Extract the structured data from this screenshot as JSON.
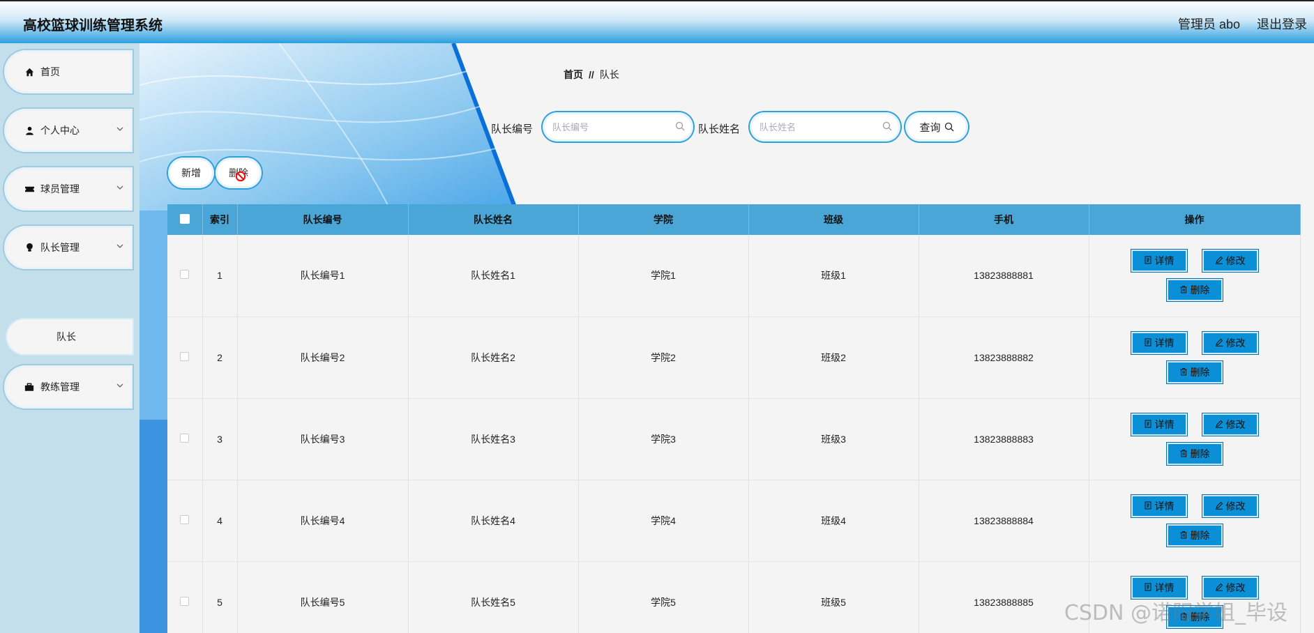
{
  "header": {
    "title": "高校篮球训练管理系统",
    "user": "管理员 abo",
    "logout": "退出登录"
  },
  "sidebar": {
    "items": [
      {
        "label": "首页",
        "icon": "home-icon"
      },
      {
        "label": "个人中心",
        "icon": "user-icon"
      },
      {
        "label": "球员管理",
        "icon": "ticket-icon"
      },
      {
        "label": "队长管理",
        "icon": "bulb-icon"
      },
      {
        "label": "教练管理",
        "icon": "briefcase-icon"
      }
    ],
    "sub_item": "队长"
  },
  "breadcrumb": {
    "home": "首页",
    "sep": "//",
    "current": "队长"
  },
  "search": {
    "field1_label": "队长编号",
    "field1_placeholder": "队长编号",
    "field2_label": "队长姓名",
    "field2_placeholder": "队长姓名",
    "query_label": "查询"
  },
  "toolbar": {
    "add_label": "新增",
    "delete_label": "删除"
  },
  "table": {
    "headers": [
      "索引",
      "队长编号",
      "队长姓名",
      "学院",
      "班级",
      "手机",
      "操作"
    ],
    "rows": [
      {
        "index": "1",
        "code": "队长编号1",
        "name": "队长姓名1",
        "college": "学院1",
        "class": "班级1",
        "phone": "13823888881"
      },
      {
        "index": "2",
        "code": "队长编号2",
        "name": "队长姓名2",
        "college": "学院2",
        "class": "班级2",
        "phone": "13823888882"
      },
      {
        "index": "3",
        "code": "队长编号3",
        "name": "队长姓名3",
        "college": "学院3",
        "class": "班级3",
        "phone": "13823888883"
      },
      {
        "index": "4",
        "code": "队长编号4",
        "name": "队长姓名4",
        "college": "学院4",
        "class": "班级4",
        "phone": "13823888884"
      },
      {
        "index": "5",
        "code": "队长编号5",
        "name": "队长姓名5",
        "college": "学院5",
        "class": "班级5",
        "phone": "13823888885"
      }
    ],
    "actions": {
      "detail": "详情",
      "edit": "修改",
      "delete": "删除"
    }
  },
  "watermark": "CSDN @诺阳学姐_毕设",
  "colors": {
    "accent": "#0b8fd6",
    "header_bg": "#4aa6d6",
    "sidebar_bg": "#c3dfec"
  }
}
